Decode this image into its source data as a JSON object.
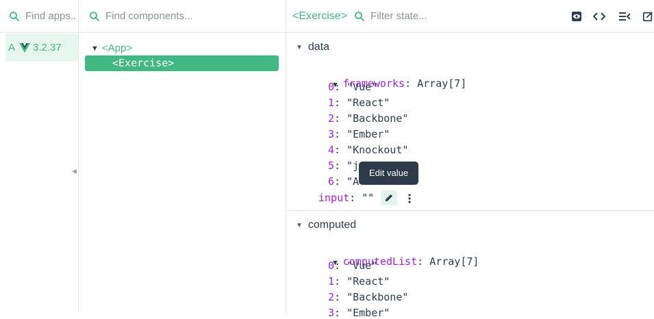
{
  "apps": {
    "search": {
      "placeholder": "Find apps..."
    },
    "items": [
      {
        "letter": "A",
        "version": "3.2.37"
      }
    ]
  },
  "tree": {
    "search": {
      "placeholder": "Find components..."
    },
    "root": "<App>",
    "selected": "<Exercise>"
  },
  "state": {
    "component": "<Exercise>",
    "filter": {
      "placeholder": "Filter state..."
    },
    "toolbar_icons": [
      "eye-icon",
      "code-icon",
      "list-collapse-icon",
      "open-in-editor-icon"
    ],
    "data_section": {
      "label": "data",
      "frameworks": {
        "key": "frameworks",
        "type": "Array[7]",
        "items": [
          {
            "index": "0",
            "value": "\"Vue\""
          },
          {
            "index": "1",
            "value": "\"React\""
          },
          {
            "index": "2",
            "value": "\"Backbone\""
          },
          {
            "index": "3",
            "value": "\"Ember\""
          },
          {
            "index": "4",
            "value": "\"Knockout\""
          },
          {
            "index": "5",
            "value": "\"j"
          },
          {
            "index": "6",
            "value": "\"A"
          }
        ]
      },
      "input": {
        "key": "input",
        "value": "\"\""
      }
    },
    "computed_section": {
      "label": "computed",
      "computedList": {
        "key": "computedList",
        "type": "Array[7]",
        "items": [
          {
            "index": "0",
            "value": "\"Vue\""
          },
          {
            "index": "1",
            "value": "\"React\""
          },
          {
            "index": "2",
            "value": "\"Backbone\""
          },
          {
            "index": "3",
            "value": "\"Ember\""
          }
        ]
      }
    },
    "tooltip": "Edit value"
  },
  "colors": {
    "accent": "#42b883",
    "key": "#a020f0",
    "text": "#2c3e50",
    "tooltip_bg": "#2d3a48"
  }
}
